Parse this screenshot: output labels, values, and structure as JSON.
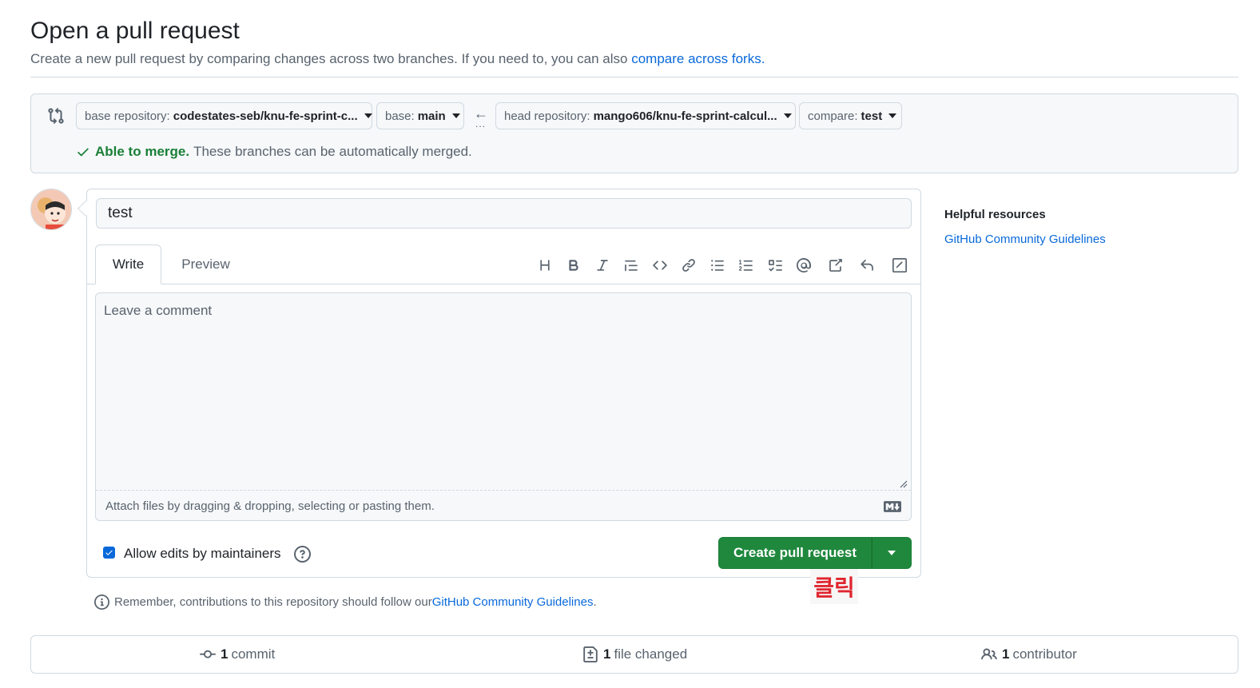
{
  "header": {
    "title": "Open a pull request",
    "subtitle": "Create a new pull request by comparing changes across two branches. If you need to, you can also ",
    "compare_forks_link": "compare across forks."
  },
  "compare": {
    "base_repo_label": "base repository:",
    "base_repo_value": "codestates-seb/knu-fe-sprint-c...",
    "base_label": "base:",
    "base_value": "main",
    "head_repo_label": "head repository:",
    "head_repo_value": "mango606/knu-fe-sprint-calcul...",
    "compare_label": "compare:",
    "compare_value": "test",
    "arrow_dots": "...",
    "merge_ok": "Able to merge.",
    "merge_text": "These branches can be automatically merged."
  },
  "form": {
    "title_value": "test",
    "tabs": {
      "write": "Write",
      "preview": "Preview"
    },
    "comment_placeholder": "Leave a comment",
    "attach_text": "Attach files by dragging & dropping, selecting or pasting them.",
    "allow_edits_label": "Allow edits by maintainers",
    "allow_edits_checked": true,
    "create_button": "Create pull request",
    "annotation": "클릭",
    "remember_prefix": "Remember, contributions to this repository should follow our ",
    "remember_link": "GitHub Community Guidelines",
    "remember_suffix": "."
  },
  "toolbar": {
    "icons": [
      "heading-icon",
      "bold-icon",
      "italic-icon",
      "quote-icon",
      "code-icon",
      "link-icon",
      "unordered-list-icon",
      "ordered-list-icon",
      "task-list-icon",
      "mention-icon",
      "reference-icon",
      "undo-icon",
      "slash-commands-icon"
    ]
  },
  "sidebar": {
    "title": "Helpful resources",
    "link": "GitHub Community Guidelines"
  },
  "stats": {
    "commits_count": "1",
    "commits_label": "commit",
    "files_count": "1",
    "files_label": "file changed",
    "contributors_count": "1",
    "contributors_label": "contributor"
  },
  "colors": {
    "primary_green": "#1f883d",
    "link_blue": "#0969da",
    "success_green": "#1a7f37",
    "annotation_red": "#e0262f"
  }
}
